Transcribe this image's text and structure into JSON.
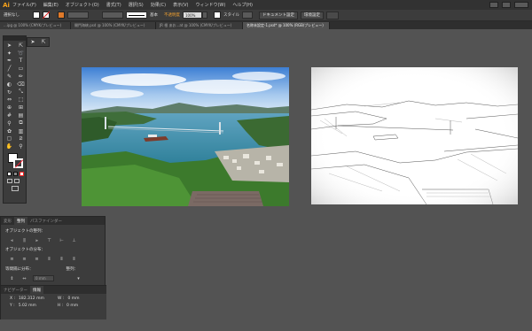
{
  "app": {
    "logo_text": "Ai"
  },
  "menu": [
    "ファイル(F)",
    "編集(E)",
    "オブジェクト(O)",
    "書式(T)",
    "選択(S)",
    "効果(C)",
    "表示(V)",
    "ウィンドウ(W)",
    "ヘルプ(H)"
  ],
  "control_bar": {
    "selection_label": "選択なし",
    "opacity_label": "不透明度",
    "opacity_value": "100%",
    "stroke_style": "基本",
    "style_label": "スタイル",
    "doc_setup_button": "ドキュメント設定",
    "preferences_button": "環境設定"
  },
  "tabs": [
    {
      "label": "...ipg @ 100% (CMYK/プレビュー)",
      "active": false
    },
    {
      "label": "開門海峡.psd @ 100% (CMYK/プレビュー)",
      "active": false
    },
    {
      "label": "JR 根 あお...at @ 100% (CMYK/プレビュー)",
      "active": false
    },
    {
      "label": "名称未設定-1.psd* @ 100% (RGB/プレビュー)",
      "active": true
    }
  ],
  "align_panel": {
    "tabs": [
      "変形",
      "整列",
      "パスファインダー"
    ],
    "align_objects_label": "オブジェクトの整列：",
    "distribute_objects_label": "オブジェクトの分布：",
    "distribute_spacing_label": "等間隔に分布：",
    "align_to_label": "整列：",
    "spacing_value": "0 mm"
  },
  "info_panel": {
    "tabs": [
      "ナビゲーター",
      "情報"
    ],
    "x_label": "X :",
    "x_value": "182.312 mm",
    "y_label": "Y :",
    "y_value": "5.02 mm",
    "w_label": "W :",
    "w_value": "0 mm",
    "h_label": "H :",
    "h_value": "0 mm"
  },
  "colors": {
    "accent": "#f7a21b",
    "workspace": "#535353",
    "panel": "#3c3c3c"
  }
}
